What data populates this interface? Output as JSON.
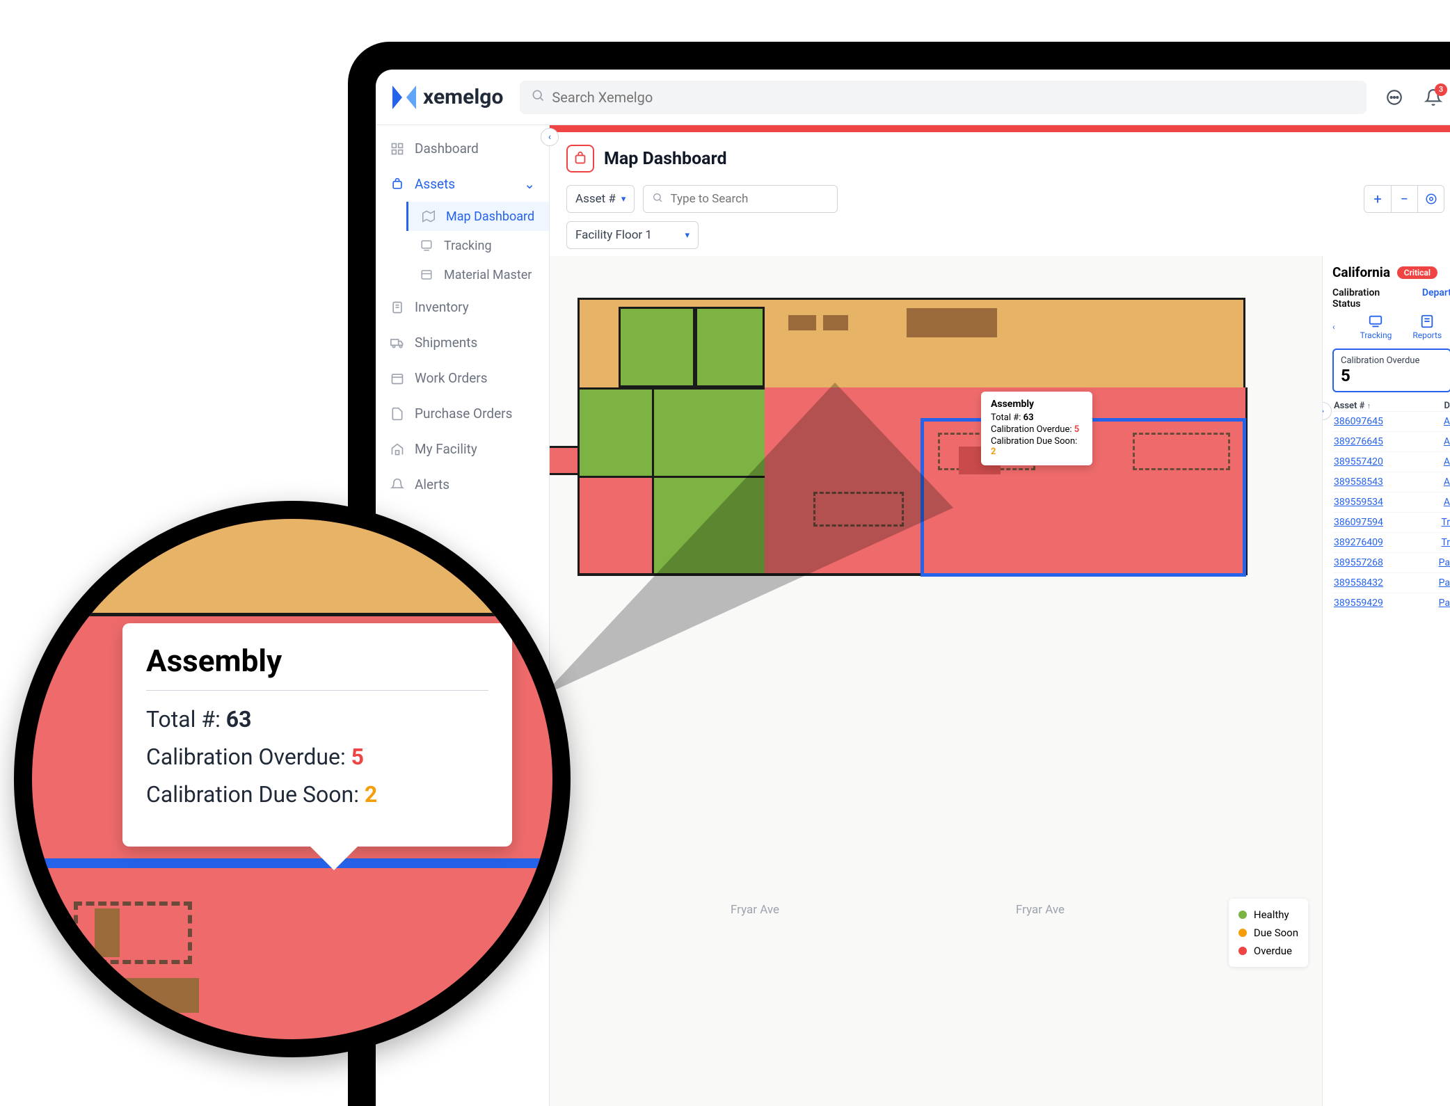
{
  "brand": {
    "name": "xemelgo"
  },
  "search": {
    "placeholder": "Search Xemelgo"
  },
  "header": {
    "notification_count": "3"
  },
  "sidebar": {
    "items": [
      {
        "label": "Dashboard"
      },
      {
        "label": "Assets",
        "children": [
          {
            "label": "Map Dashboard"
          },
          {
            "label": "Tracking"
          },
          {
            "label": "Material Master"
          }
        ]
      },
      {
        "label": "Inventory"
      },
      {
        "label": "Shipments"
      },
      {
        "label": "Work Orders"
      },
      {
        "label": "Purchase Orders"
      },
      {
        "label": "My Facility"
      },
      {
        "label": "Alerts"
      }
    ]
  },
  "page": {
    "title": "Map Dashboard"
  },
  "filters": {
    "asset_field": "Asset #",
    "search_placeholder": "Type to Search",
    "floor": "Facility Floor 1"
  },
  "map": {
    "road_a": "Fryar Ave",
    "road_b": "Fryar Ave",
    "legend": {
      "healthy": "Healthy",
      "due_soon": "Due Soon",
      "overdue": "Overdue"
    },
    "colors": {
      "healthy": "#7cb342",
      "due_soon": "#f59e0b",
      "overdue": "#ef4444"
    }
  },
  "tooltip": {
    "title": "Assembly",
    "total_label": "Total #:",
    "total_value": "63",
    "overdue_label": "Calibration Overdue:",
    "overdue_value": "5",
    "due_soon_label": "Calibration Due Soon:",
    "due_soon_value": "2"
  },
  "right": {
    "region": "California",
    "status_badge": "Critical",
    "tab_a": "Calibration Status",
    "tab_b": "Depart",
    "icon_tabs": {
      "tracking": "Tracking",
      "reports": "Reports"
    },
    "card": {
      "label": "Calibration Overdue",
      "value": "5"
    },
    "table": {
      "col_asset": "Asset #",
      "col_d": "D",
      "rows": [
        {
          "asset": "386097645",
          "d": "A"
        },
        {
          "asset": "389276645",
          "d": "A"
        },
        {
          "asset": "389557420",
          "d": "A"
        },
        {
          "asset": "389558543",
          "d": "A"
        },
        {
          "asset": "389559534",
          "d": "A"
        },
        {
          "asset": "386097594",
          "d": "Tr"
        },
        {
          "asset": "389276409",
          "d": "Tr"
        },
        {
          "asset": "389557268",
          "d": "Pa"
        },
        {
          "asset": "389558432",
          "d": "Pa"
        },
        {
          "asset": "389559429",
          "d": "Pa"
        }
      ]
    }
  },
  "magnifier": {
    "title": "Assembly",
    "total_label": "Total #:",
    "total_value": "63",
    "overdue_label": "Calibration Overdue:",
    "overdue_value": "5",
    "due_soon_label": "Calibration Due Soon:",
    "due_soon_value": "2"
  }
}
